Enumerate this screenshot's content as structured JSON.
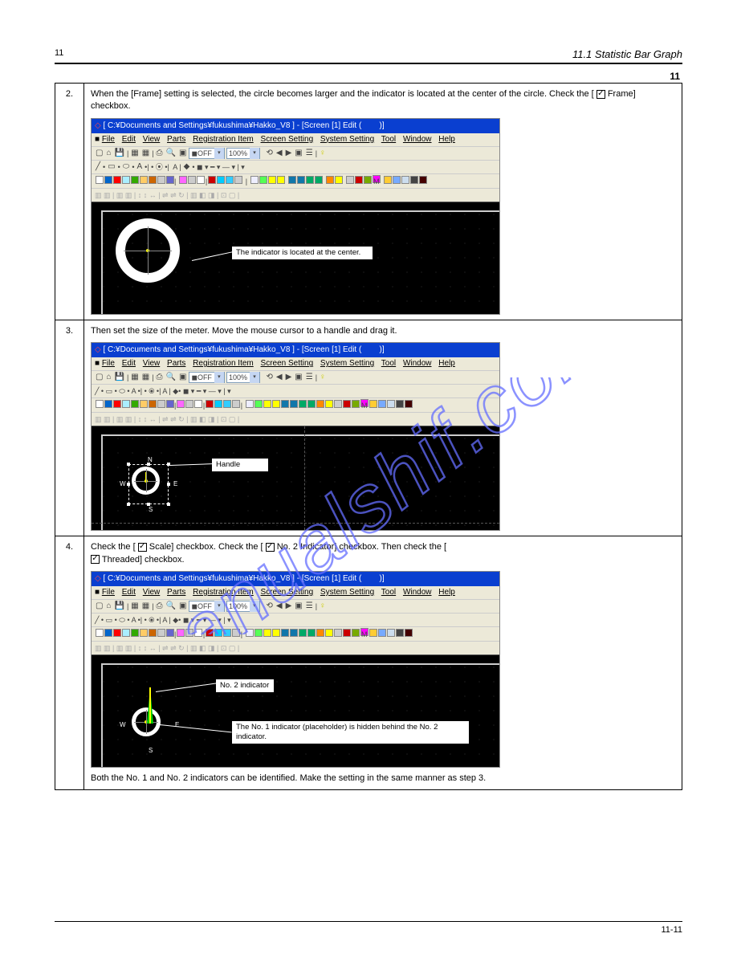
{
  "header": {
    "chapter": "11",
    "section_title": "11.1   Statistic Bar Graph",
    "section_num": "11"
  },
  "footer": {
    "page": "11-11"
  },
  "steps": {
    "n2": "2.",
    "n3": "3.",
    "n4": "4."
  },
  "row2": {
    "para": "When the [Frame] setting is selected, the circle becomes larger and the indicator is located at the center of the circle. Check the [ ",
    "para_b": " Frame] checkbox.",
    "callout": "The indicator is located at the center."
  },
  "row3": {
    "para": "Then set the size of the meter. Move the mouse cursor to a handle and drag it.",
    "callout": "Handle"
  },
  "row4": {
    "para1a": "Check the [ ",
    "para1b": " Scale] checkbox. Check the [ ",
    "para1c": " No. 2 Indicator] checkbox. Then check the [ ",
    "para1d": " Threaded] checkbox.",
    "para2": "Both the No. 1 and No. 2 indicators can be identified. Make the setting in the same manner as step 3.",
    "callout1": "No. 2 indicator",
    "callout2": "The No. 1 indicator (placeholder) is hidden behind the No. 2 indicator."
  },
  "ss": {
    "titlebar": "[ C:¥Documents and Settings¥fukushima¥Hakko_V8 ] - [Screen [1] Edit (",
    "titlebar_r": ")]",
    "menu": {
      "file": "File",
      "edit": "Edit",
      "view": "View",
      "parts": "Parts",
      "reg": "Registration Item",
      "screen": "Screen Setting",
      "sys": "System Setting",
      "tool": "Tool",
      "win": "Window",
      "help": "Help"
    },
    "combo_off": "OFF",
    "combo_zoom": "100%"
  },
  "nesw": {
    "n": "N",
    "e": "E",
    "s": "S",
    "w": "W"
  }
}
